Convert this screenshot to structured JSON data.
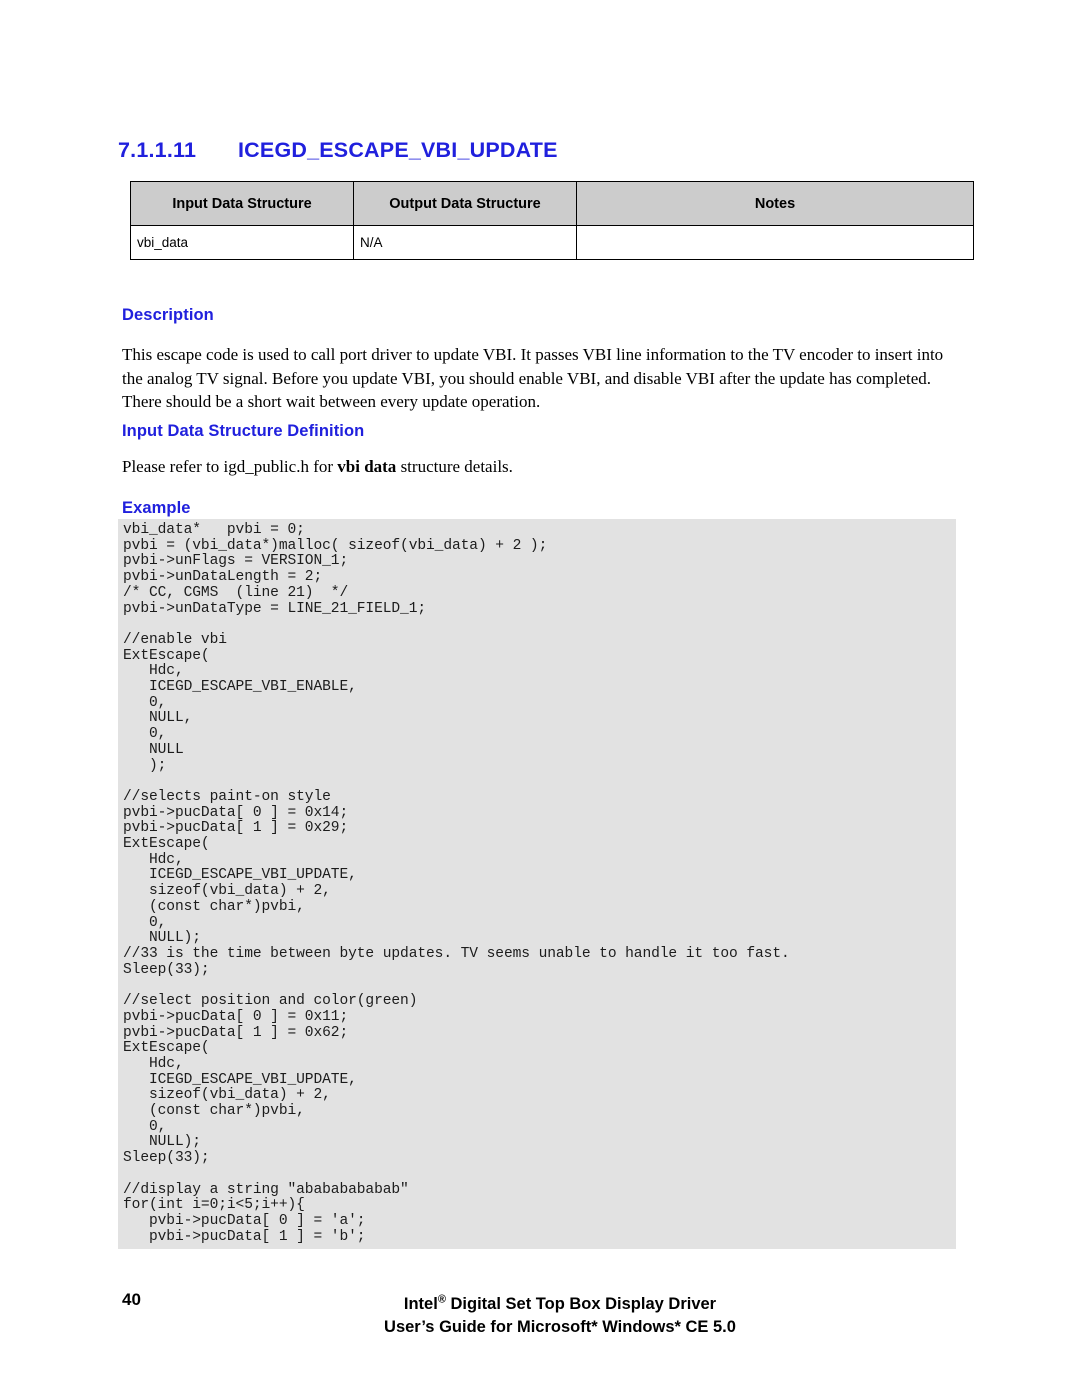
{
  "document": {
    "section": {
      "number": "7.1.1.11",
      "title": "ICEGD_ESCAPE_VBI_UPDATE"
    },
    "summary_table": {
      "headers": [
        "Input Data Structure",
        "Output Data Structure",
        "Notes"
      ],
      "rows": [
        [
          "vbi_data",
          "N/A",
          ""
        ]
      ]
    },
    "headings": {
      "description": "Description",
      "input_data_structure_definition": "Input Data Structure Definition",
      "example": "Example"
    },
    "paragraphs": {
      "description": "This escape code is used to call port driver to update VBI. It passes VBI line information to the TV encoder to insert into the analog TV signal. Before you update VBI, you should enable VBI, and disable VBI after the update has completed. There should be a short wait between every update operation.",
      "input_def_prefix": "Please refer to igd_public.h for ",
      "input_def_bold": "vbi data",
      "input_def_suffix": " structure details."
    },
    "code": {
      "lines": [
        "vbi_data*   pvbi = 0;",
        "pvbi = (vbi_data*)malloc( sizeof(vbi_data) + 2 );",
        "pvbi->unFlags = VERSION_1;",
        "pvbi->unDataLength = 2;",
        "/* CC, CGMS  (line 21)  */",
        "pvbi->unDataType = LINE_21_FIELD_1;",
        "",
        "//enable vbi",
        "ExtEscape(",
        "   Hdc,",
        "   ICEGD_ESCAPE_VBI_ENABLE,",
        "   0,",
        "   NULL,",
        "   0,",
        "   NULL",
        "   );",
        "",
        "//selects paint-on style",
        "pvbi->pucData[ 0 ] = 0x14;",
        "pvbi->pucData[ 1 ] = 0x29;",
        "ExtEscape(",
        "   Hdc,",
        "   ICEGD_ESCAPE_VBI_UPDATE,",
        "   sizeof(vbi_data) + 2,",
        "   (const char*)pvbi,",
        "   0,",
        "   NULL);",
        "//33 is the time between byte updates. TV seems unable to handle it too fast.",
        "Sleep(33);",
        "",
        "//select position and color(green)",
        "pvbi->pucData[ 0 ] = 0x11;",
        "pvbi->pucData[ 1 ] = 0x62;",
        "ExtEscape(",
        "   Hdc,",
        "   ICEGD_ESCAPE_VBI_UPDATE,",
        "   sizeof(vbi_data) + 2,",
        "   (const char*)pvbi,",
        "   0,",
        "   NULL);",
        "Sleep(33);",
        "",
        "//display a string \"abababababab\"",
        "for(int i=0;i<5;i++){",
        "   pvbi->pucData[ 0 ] = 'a';",
        "   pvbi->pucData[ 1 ] = 'b';"
      ]
    },
    "footer": {
      "page_number": "40",
      "line1_prefix": "Intel",
      "line1_registered": "®",
      "line1_suffix": " Digital Set Top Box Display Driver",
      "line2": "User’s Guide for Microsoft* Windows* CE 5.0"
    },
    "colors": {
      "heading_blue": "#2020DD",
      "table_header_gray": "#CCCCCC",
      "code_background": "#E2E2E2",
      "text_black": "#000000"
    }
  }
}
